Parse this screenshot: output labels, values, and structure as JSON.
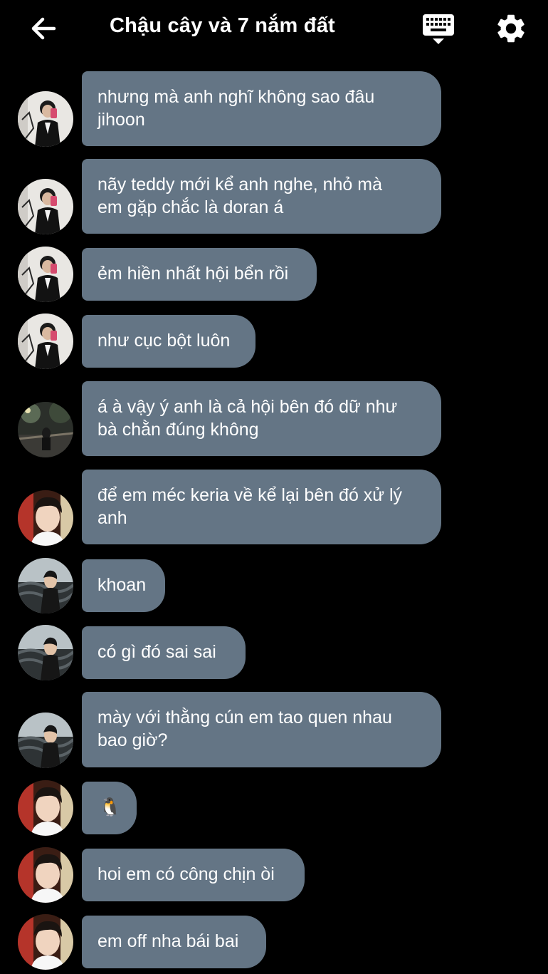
{
  "header": {
    "title": "Chậu cây và 7 nắm đất"
  },
  "messages": [
    {
      "text": "nhưng mà anh nghĩ không sao đâu\njihoon",
      "avatar": "avatar-suit"
    },
    {
      "text": "nãy teddy mới kể anh nghe, nhỏ mà\nem gặp chắc là doran á",
      "avatar": "avatar-suit"
    },
    {
      "text": "ẻm hiền nhất hội bển rồi",
      "avatar": "avatar-suit"
    },
    {
      "text": "như cục bột luôn",
      "avatar": "avatar-suit"
    },
    {
      "text": "á à vậy ý anh là cả hội bên đó dữ như\nbà chằn đúng không",
      "avatar": "avatar-night"
    },
    {
      "text": "để em méc keria về kể lại bên đó xử lý\nanh",
      "avatar": "avatar-boy"
    },
    {
      "text": "khoan",
      "avatar": "avatar-outdoor"
    },
    {
      "text": "có gì đó sai sai",
      "avatar": "avatar-outdoor"
    },
    {
      "text": "mày với thằng cún em tao quen nhau\nbao giờ?",
      "avatar": "avatar-outdoor"
    },
    {
      "text": "🐧",
      "avatar": "avatar-boy"
    },
    {
      "text": "hoi em có công chịn òi",
      "avatar": "avatar-boy"
    },
    {
      "text": "em off nha bái bai",
      "avatar": "avatar-boy"
    }
  ],
  "colors": {
    "background": "#000000",
    "bubble": "#647585",
    "text": "#ffffff"
  }
}
